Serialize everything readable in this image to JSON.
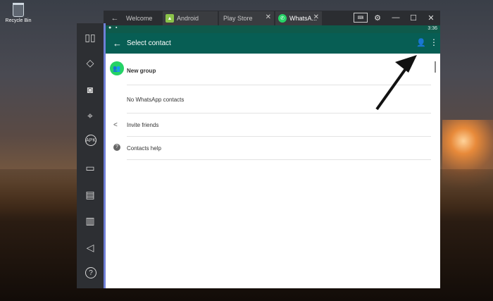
{
  "desktop": {
    "recycle_bin_label": "Recycle Bin"
  },
  "tabs": [
    {
      "label": "Welcome",
      "icon": "back-arrow-icon"
    },
    {
      "label": "Android",
      "icon": "android-icon"
    },
    {
      "label": "Play Store",
      "icon": ""
    },
    {
      "label": "WhatsA...",
      "icon": "whatsapp-icon"
    }
  ],
  "status_bar": {
    "time": "3:36"
  },
  "app_bar": {
    "title": "Select contact"
  },
  "list": {
    "new_group": "New group",
    "no_contacts": "No WhatsApp contacts",
    "invite": "Invite friends",
    "help": "Contacts help"
  },
  "colors": {
    "whatsapp_dark": "#075e54",
    "whatsapp_green": "#25d366",
    "sidebar_accent": "#6f7fd6"
  }
}
